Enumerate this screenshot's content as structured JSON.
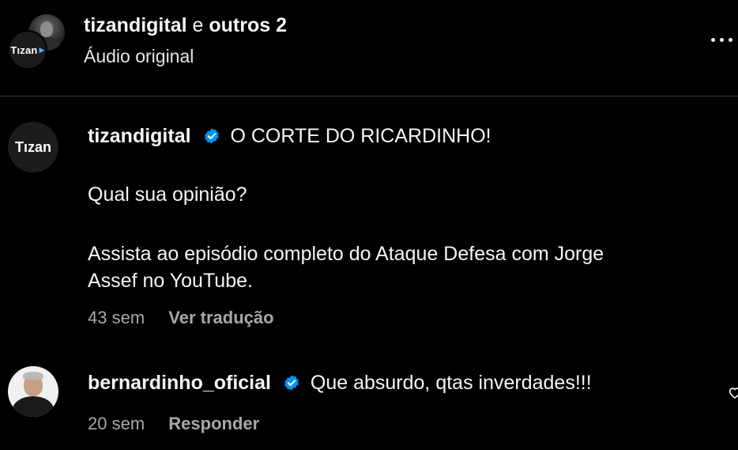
{
  "header": {
    "author": "tizandigital",
    "joiner": "e",
    "others": "outros 2",
    "audio": "Áudio original",
    "logo_text": "Tızan"
  },
  "caption": {
    "logo_text": "Tızan",
    "username": "tizandigital",
    "verified": true,
    "line1": "O CORTE DO RICARDINHO!",
    "line2": "Qual sua opinião?",
    "line3a": "Assista ao episódio completo do Ataque Defesa com Jorge",
    "line3b": "Assef no YouTube.",
    "time": "43 sem",
    "action": "Ver tradução"
  },
  "comment": {
    "username": "bernardinho_oficial",
    "verified": true,
    "text": "Que absurdo, qtas inverdades!!!",
    "time": "20 sem",
    "action": "Responder"
  },
  "icons": {
    "verified": "verified-badge-icon",
    "more": "more-options-icon",
    "like": "heart-outline-icon"
  },
  "colors": {
    "background": "#000000",
    "text": "#f5f5f5",
    "muted": "#a8a8a8",
    "verified": "#0095f6"
  }
}
